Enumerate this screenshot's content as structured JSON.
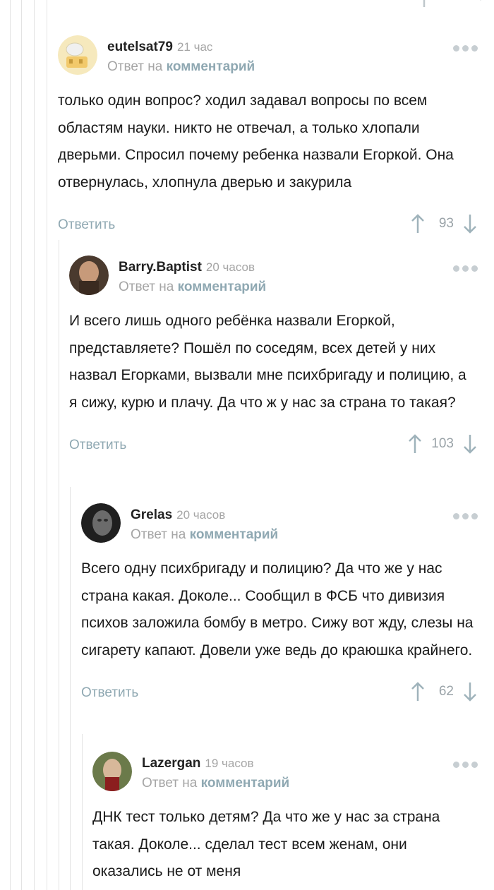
{
  "top_dots_hint": "",
  "comments": [
    {
      "username": "eutelsat79",
      "time": "21 час",
      "reply_prefix": "Ответ на",
      "reply_link": "комментарий",
      "text": "только один вопрос? ходил задавал вопросы по всем областям науки. никто не отвечал, а только хлопали дверьми. Спросил почему ребенка назвали Егоркой. Она отвернулась, хлопнула дверью и закурила",
      "answer_label": "Ответить",
      "rating": "93"
    },
    {
      "username": "Barry.Baptist",
      "time": "20 часов",
      "reply_prefix": "Ответ на",
      "reply_link": "комментарий",
      "text": "И всего лишь одного ребёнка назвали Егоркой, представляете? Пошёл по соседям, всех детей у них назвал Егорками, вызвали мне психбригаду и полицию, а я сижу, курю и плачу. Да что ж у нас за страна то такая?",
      "answer_label": "Ответить",
      "rating": "103"
    },
    {
      "username": "Grelas",
      "time": "20 часов",
      "reply_prefix": "Ответ на",
      "reply_link": "комментарий",
      "text": "Всего одну психбригаду и полицию? Да что же у нас страна какая. Доколе... Сообщил в ФСБ что дивизия психов заложила бомбу в метро. Сижу вот жду, слезы на сигарету капают. Довели уже ведь до краюшка крайнего.",
      "answer_label": "Ответить",
      "rating": "62"
    },
    {
      "username": "Lazergan",
      "time": "19 часов",
      "reply_prefix": "Ответ на",
      "reply_link": "комментарий",
      "text": "ДНК тест только детям? Да что же у нас за страна такая. Доколе... сделал тест всем женам, они оказались не от меня"
    }
  ]
}
